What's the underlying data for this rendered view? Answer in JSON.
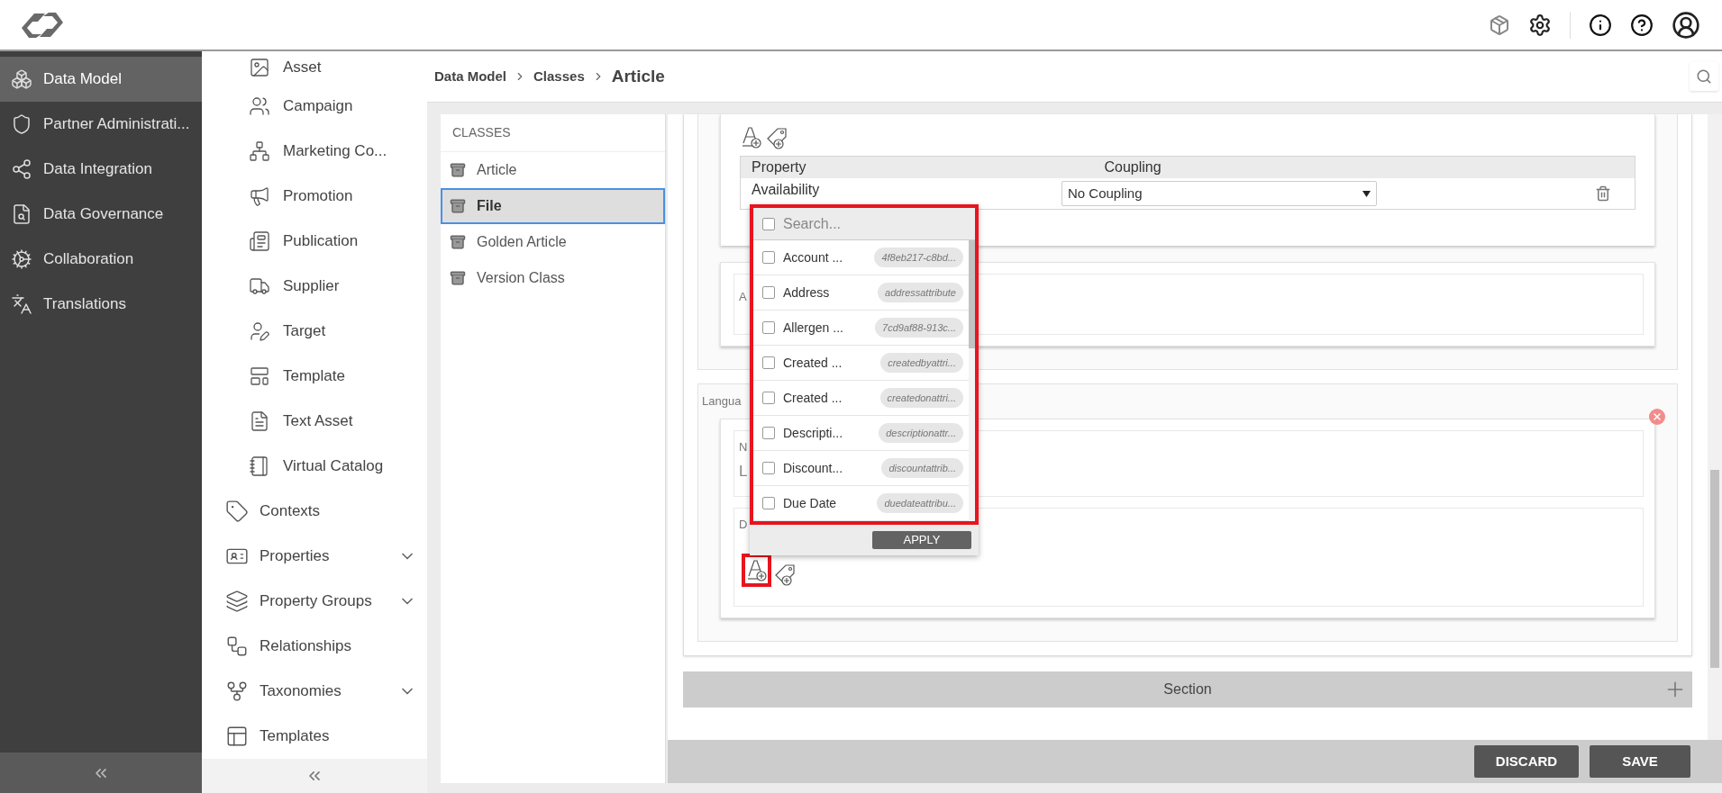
{
  "main_nav": {
    "items": [
      {
        "label": "Data Model",
        "selected": true
      },
      {
        "label": "Partner Administrati...",
        "selected": false
      },
      {
        "label": "Data Integration",
        "selected": false
      },
      {
        "label": "Data Governance",
        "selected": false
      },
      {
        "label": "Collaboration",
        "selected": false
      },
      {
        "label": "Translations",
        "selected": false
      }
    ]
  },
  "sub_nav": {
    "class_items": [
      "Asset",
      "Campaign",
      "Marketing Co...",
      "Promotion",
      "Publication",
      "Supplier",
      "Target",
      "Template",
      "Text Asset",
      "Virtual Catalog"
    ],
    "items": [
      {
        "label": "Contexts",
        "expandable": false
      },
      {
        "label": "Properties",
        "expandable": true
      },
      {
        "label": "Property Groups",
        "expandable": true
      },
      {
        "label": "Relationships",
        "expandable": false
      },
      {
        "label": "Taxonomies",
        "expandable": true
      },
      {
        "label": "Templates",
        "expandable": false
      }
    ]
  },
  "breadcrumb": [
    "Data Model",
    "Classes",
    "Article"
  ],
  "classes": {
    "heading": "CLASSES",
    "items": [
      {
        "label": "Article",
        "selected": false
      },
      {
        "label": "File",
        "selected": true
      },
      {
        "label": "Golden Article",
        "selected": false
      },
      {
        "label": "Version Class",
        "selected": false
      }
    ]
  },
  "property_table": {
    "columns": [
      "Property",
      "Coupling"
    ],
    "rows": [
      {
        "property": "Availability",
        "coupling": "No Coupling"
      }
    ]
  },
  "attribute_field": {
    "label": "A"
  },
  "language_section": {
    "label": "Langua"
  },
  "name_field": {
    "label": "N",
    "value": "L"
  },
  "d_field": {
    "label": "D"
  },
  "popup": {
    "search_placeholder": "Search...",
    "select_all_checked": false,
    "options": [
      {
        "label": "Account ...",
        "code": "4f8eb217-c8bd...",
        "checked": false
      },
      {
        "label": "Address",
        "code": "addressattribute",
        "checked": false
      },
      {
        "label": "Allergen ...",
        "code": "7cd9af88-913c...",
        "checked": false
      },
      {
        "label": "Created ...",
        "code": "createdbyattri...",
        "checked": false
      },
      {
        "label": "Created ...",
        "code": "createdonattri...",
        "checked": false
      },
      {
        "label": "Descripti...",
        "code": "descriptionattr...",
        "checked": false
      },
      {
        "label": "Discount...",
        "code": "discountattrib...",
        "checked": false
      },
      {
        "label": "Due Date",
        "code": "duedateattribu...",
        "checked": false
      }
    ],
    "apply": "APPLY"
  },
  "section": {
    "title": "Section"
  },
  "actions": {
    "discard": "DISCARD",
    "save": "SAVE"
  }
}
